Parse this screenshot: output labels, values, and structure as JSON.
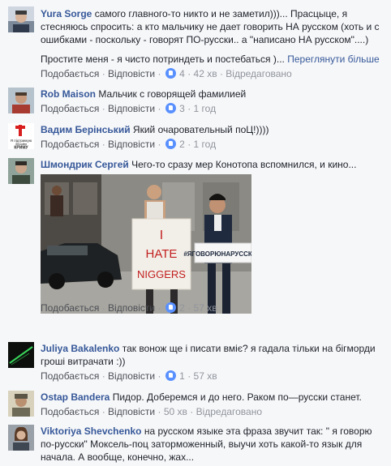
{
  "actions": {
    "like": "Подобається",
    "reply": "Відповісти",
    "dot": "·",
    "edited": "Відредаговано"
  },
  "comments": [
    {
      "author": "Yura Sorge",
      "text_lines": [
        "самого главного-то никто и не заметил)))... Прасцыце, я",
        "стесняюсь спросить: а кто мальчику не дает говорить НА русском (хоть и с",
        "ошибками - поскольку - говорят ПО-русски.. а \"написано НА русском\"....)"
      ],
      "text_line2": "Простите меня - я чисто потриндеть и постебаться )...",
      "see_more": "Переглянути більше",
      "likes": "4",
      "time": "42 хв",
      "edited": true
    },
    {
      "author": "Rob Maison",
      "text": "Мальчик с говорящей фамилией",
      "likes": "3",
      "time": "1 год"
    },
    {
      "author": "Вадим Берінський",
      "text": "Який очаровательный поЦ!))))",
      "avatar_caption": "Я підтримую Збройні КРИМУ",
      "likes": "2",
      "time": "1 год"
    },
    {
      "author": "Шмондрик Сергей",
      "text": "Чего-то сразу мер Конотопа вспомнился, и кино...",
      "photo_sign_left": [
        "I",
        "HATE",
        "NIGGERS"
      ],
      "photo_sign_right": "#ЯГОВОРЮНАРУССКОМ",
      "likes": "2",
      "time": "57 хв"
    },
    {
      "author": "Juliya Bakalenko",
      "text_lines": [
        "так вонож ще і писати вміє? я гадала тільки на бігморди",
        "гроші витрачати :))"
      ],
      "likes": "1",
      "time": "57 хв"
    },
    {
      "author": "Ostap Bandera",
      "text": "Пидор. Доберемся и до него. Раком по—русски станет.",
      "time": "50 хв",
      "edited": true
    },
    {
      "author": "Viktoriya Shevchenko",
      "text_lines": [
        "на русском языке эта фраза звучит так: \" я говорю",
        "по-русски\" Моксель-поц заторможенный, выучи хоть какой-то язык для",
        "начала. А вообще, конечно, жах..."
      ]
    }
  ]
}
